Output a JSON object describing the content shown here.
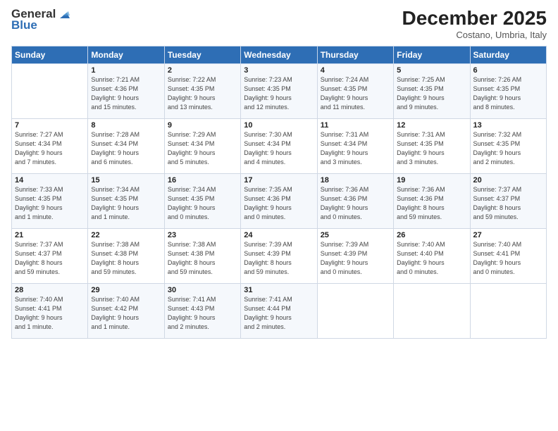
{
  "logo": {
    "line1": "General",
    "line2": "Blue"
  },
  "title": "December 2025",
  "location": "Costano, Umbria, Italy",
  "headers": [
    "Sunday",
    "Monday",
    "Tuesday",
    "Wednesday",
    "Thursday",
    "Friday",
    "Saturday"
  ],
  "weeks": [
    [
      {
        "day": "",
        "info": ""
      },
      {
        "day": "1",
        "info": "Sunrise: 7:21 AM\nSunset: 4:36 PM\nDaylight: 9 hours\nand 15 minutes."
      },
      {
        "day": "2",
        "info": "Sunrise: 7:22 AM\nSunset: 4:35 PM\nDaylight: 9 hours\nand 13 minutes."
      },
      {
        "day": "3",
        "info": "Sunrise: 7:23 AM\nSunset: 4:35 PM\nDaylight: 9 hours\nand 12 minutes."
      },
      {
        "day": "4",
        "info": "Sunrise: 7:24 AM\nSunset: 4:35 PM\nDaylight: 9 hours\nand 11 minutes."
      },
      {
        "day": "5",
        "info": "Sunrise: 7:25 AM\nSunset: 4:35 PM\nDaylight: 9 hours\nand 9 minutes."
      },
      {
        "day": "6",
        "info": "Sunrise: 7:26 AM\nSunset: 4:35 PM\nDaylight: 9 hours\nand 8 minutes."
      }
    ],
    [
      {
        "day": "7",
        "info": "Sunrise: 7:27 AM\nSunset: 4:34 PM\nDaylight: 9 hours\nand 7 minutes."
      },
      {
        "day": "8",
        "info": "Sunrise: 7:28 AM\nSunset: 4:34 PM\nDaylight: 9 hours\nand 6 minutes."
      },
      {
        "day": "9",
        "info": "Sunrise: 7:29 AM\nSunset: 4:34 PM\nDaylight: 9 hours\nand 5 minutes."
      },
      {
        "day": "10",
        "info": "Sunrise: 7:30 AM\nSunset: 4:34 PM\nDaylight: 9 hours\nand 4 minutes."
      },
      {
        "day": "11",
        "info": "Sunrise: 7:31 AM\nSunset: 4:34 PM\nDaylight: 9 hours\nand 3 minutes."
      },
      {
        "day": "12",
        "info": "Sunrise: 7:31 AM\nSunset: 4:35 PM\nDaylight: 9 hours\nand 3 minutes."
      },
      {
        "day": "13",
        "info": "Sunrise: 7:32 AM\nSunset: 4:35 PM\nDaylight: 9 hours\nand 2 minutes."
      }
    ],
    [
      {
        "day": "14",
        "info": "Sunrise: 7:33 AM\nSunset: 4:35 PM\nDaylight: 9 hours\nand 1 minute."
      },
      {
        "day": "15",
        "info": "Sunrise: 7:34 AM\nSunset: 4:35 PM\nDaylight: 9 hours\nand 1 minute."
      },
      {
        "day": "16",
        "info": "Sunrise: 7:34 AM\nSunset: 4:35 PM\nDaylight: 9 hours\nand 0 minutes."
      },
      {
        "day": "17",
        "info": "Sunrise: 7:35 AM\nSunset: 4:36 PM\nDaylight: 9 hours\nand 0 minutes."
      },
      {
        "day": "18",
        "info": "Sunrise: 7:36 AM\nSunset: 4:36 PM\nDaylight: 9 hours\nand 0 minutes."
      },
      {
        "day": "19",
        "info": "Sunrise: 7:36 AM\nSunset: 4:36 PM\nDaylight: 8 hours\nand 59 minutes."
      },
      {
        "day": "20",
        "info": "Sunrise: 7:37 AM\nSunset: 4:37 PM\nDaylight: 8 hours\nand 59 minutes."
      }
    ],
    [
      {
        "day": "21",
        "info": "Sunrise: 7:37 AM\nSunset: 4:37 PM\nDaylight: 8 hours\nand 59 minutes."
      },
      {
        "day": "22",
        "info": "Sunrise: 7:38 AM\nSunset: 4:38 PM\nDaylight: 8 hours\nand 59 minutes."
      },
      {
        "day": "23",
        "info": "Sunrise: 7:38 AM\nSunset: 4:38 PM\nDaylight: 8 hours\nand 59 minutes."
      },
      {
        "day": "24",
        "info": "Sunrise: 7:39 AM\nSunset: 4:39 PM\nDaylight: 8 hours\nand 59 minutes."
      },
      {
        "day": "25",
        "info": "Sunrise: 7:39 AM\nSunset: 4:39 PM\nDaylight: 9 hours\nand 0 minutes."
      },
      {
        "day": "26",
        "info": "Sunrise: 7:40 AM\nSunset: 4:40 PM\nDaylight: 9 hours\nand 0 minutes."
      },
      {
        "day": "27",
        "info": "Sunrise: 7:40 AM\nSunset: 4:41 PM\nDaylight: 9 hours\nand 0 minutes."
      }
    ],
    [
      {
        "day": "28",
        "info": "Sunrise: 7:40 AM\nSunset: 4:41 PM\nDaylight: 9 hours\nand 1 minute."
      },
      {
        "day": "29",
        "info": "Sunrise: 7:40 AM\nSunset: 4:42 PM\nDaylight: 9 hours\nand 1 minute."
      },
      {
        "day": "30",
        "info": "Sunrise: 7:41 AM\nSunset: 4:43 PM\nDaylight: 9 hours\nand 2 minutes."
      },
      {
        "day": "31",
        "info": "Sunrise: 7:41 AM\nSunset: 4:44 PM\nDaylight: 9 hours\nand 2 minutes."
      },
      {
        "day": "",
        "info": ""
      },
      {
        "day": "",
        "info": ""
      },
      {
        "day": "",
        "info": ""
      }
    ]
  ]
}
